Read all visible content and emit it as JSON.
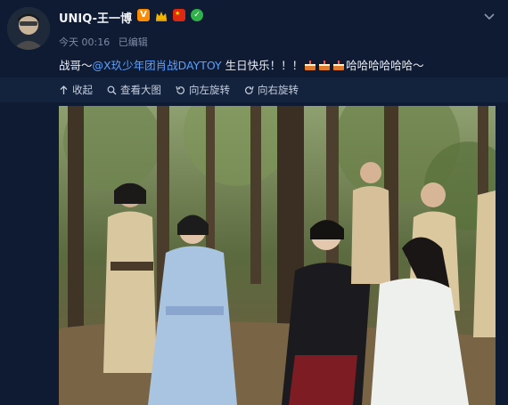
{
  "header": {
    "username": "UNIQ-王一博",
    "time": "今天 00:16",
    "edited": "已编辑",
    "badges": [
      "verified-v-icon",
      "crown-icon",
      "china-flag-icon",
      "checkmark-circle-icon"
    ]
  },
  "post": {
    "prefix": "战哥～",
    "mention": "@X玖少年团肖战DAYTOY",
    "middle": " 生日快乐！！！",
    "suffix": "哈哈哈哈哈哈～",
    "emoji": [
      "cake-icon",
      "cake-icon",
      "cake-icon"
    ]
  },
  "toolbar": {
    "collapse": "收起",
    "view_large": "查看大图",
    "rotate_left": "向左旋转",
    "rotate_right": "向右旋转"
  },
  "colors": {
    "background": "#0f1b33",
    "toolbar": "#13223d",
    "link": "#5aa0ff",
    "meta": "#7c8aa3"
  }
}
